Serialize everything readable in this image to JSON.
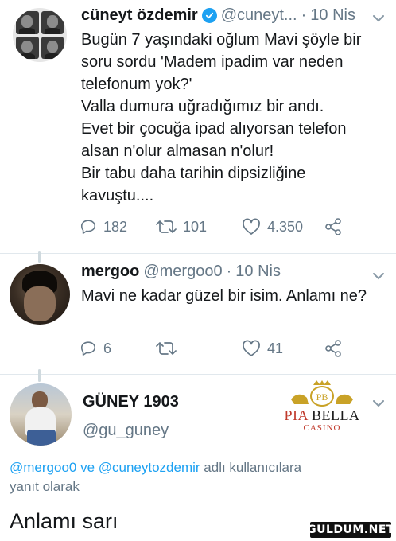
{
  "tweet1": {
    "name": "cüneyt özdemir",
    "handle": "@cuneyt...",
    "separator": "·",
    "date": "10 Nis",
    "text": "Bugün 7 yaşındaki oğlum Mavi şöyle bir\nsoru sordu 'Madem ipadim var neden\ntelefonum yok?'\nValla dumura uğradığımız bir andı.\nEvet bir çocuğa ipad alıyorsan telefon\nalsan n'olur almasan n'olur!\nBir tabu daha tarihin dipsizliğine\nkavuştu....",
    "replies": "182",
    "retweets": "101",
    "likes": "4.350"
  },
  "tweet2": {
    "name": "mergoo",
    "handle": "@mergoo0",
    "separator": "·",
    "date": "10 Nis",
    "text": "Mavi ne kadar güzel bir isim. Anlamı ne?",
    "replies": "6",
    "retweets": "",
    "likes": "41"
  },
  "tweet3": {
    "name": "GÜNEY 1903",
    "handle": "@gu_guney",
    "logo_text_1": "PIA",
    "logo_text_2": "BELLA",
    "logo_sub": "CASINO",
    "logo_crest": "PB",
    "reply_to_users": "@mergoo0 ve @cuneytozdemir",
    "reply_to_suffix": " adlı kullanıcılara",
    "reply_to_line2": "yanıt olarak",
    "text": "Anlamı sarı"
  },
  "watermark": "GULDUM.NET",
  "colors": {
    "accent": "#1da1f2",
    "muted": "#657786",
    "text": "#14171a",
    "divider": "#e1e8ed"
  },
  "icons": [
    "verified-badge-icon",
    "chevron-down-icon",
    "reply-icon",
    "retweet-icon",
    "like-icon",
    "share-icon"
  ]
}
